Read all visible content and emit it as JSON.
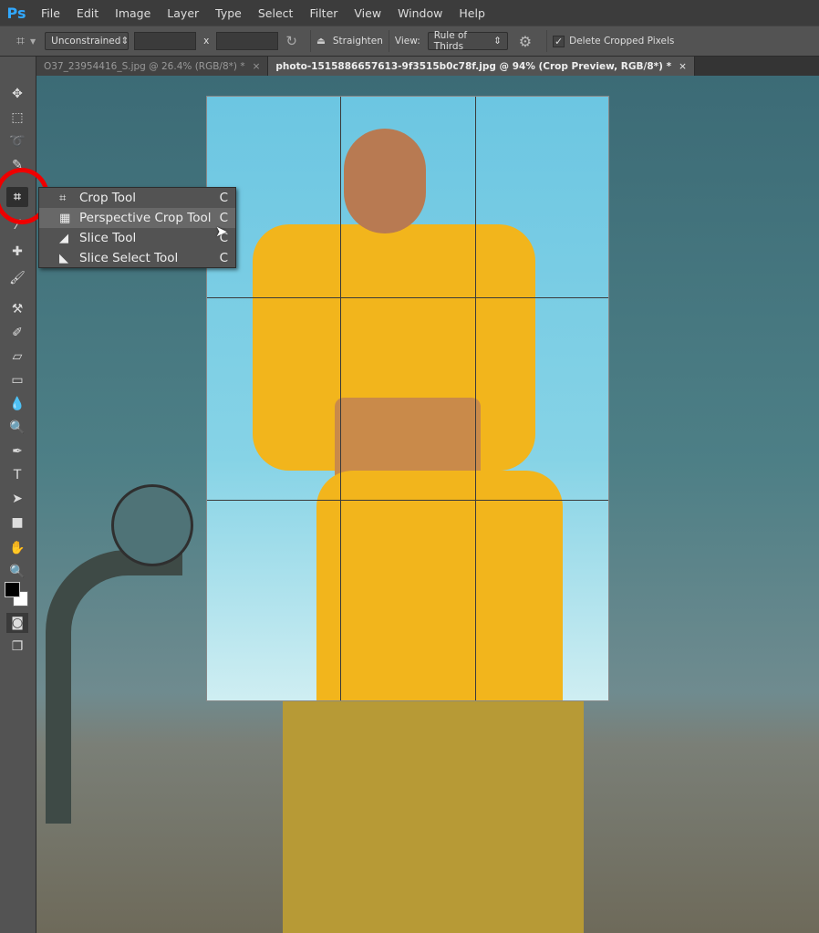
{
  "app": {
    "logo": "Ps"
  },
  "menu": [
    "File",
    "Edit",
    "Image",
    "Layer",
    "Type",
    "Select",
    "Filter",
    "View",
    "Window",
    "Help"
  ],
  "options": {
    "ratio": "Unconstrained",
    "width": "",
    "height": "",
    "x_label": "x",
    "straighten": "Straighten",
    "view_label": "View:",
    "view_value": "Rule of Thirds",
    "delete_cropped": "Delete Cropped Pixels",
    "delete_checked": true
  },
  "tabs": [
    {
      "label": "O37_23954416_S.jpg @ 26.4% (RGB/8*) *",
      "active": false
    },
    {
      "label": "photo-1515886657613-9f3515b0c78f.jpg @ 94% (Crop Preview, RGB/8*) *",
      "active": true
    }
  ],
  "close_glyph": "×",
  "flyout": [
    {
      "label": "Crop Tool",
      "key": "C",
      "icon": "crop-icon"
    },
    {
      "label": "Perspective Crop Tool",
      "key": "C",
      "icon": "perspective-crop-icon",
      "highlighted": true
    },
    {
      "label": "Slice Tool",
      "key": "C",
      "icon": "slice-icon"
    },
    {
      "label": "Slice Select Tool",
      "key": "C",
      "icon": "slice-select-icon"
    }
  ],
  "colors": {
    "accent": "#31a8ff",
    "highlight_ring": "#e00000",
    "foreground": "#000000",
    "background": "#ffffff"
  }
}
